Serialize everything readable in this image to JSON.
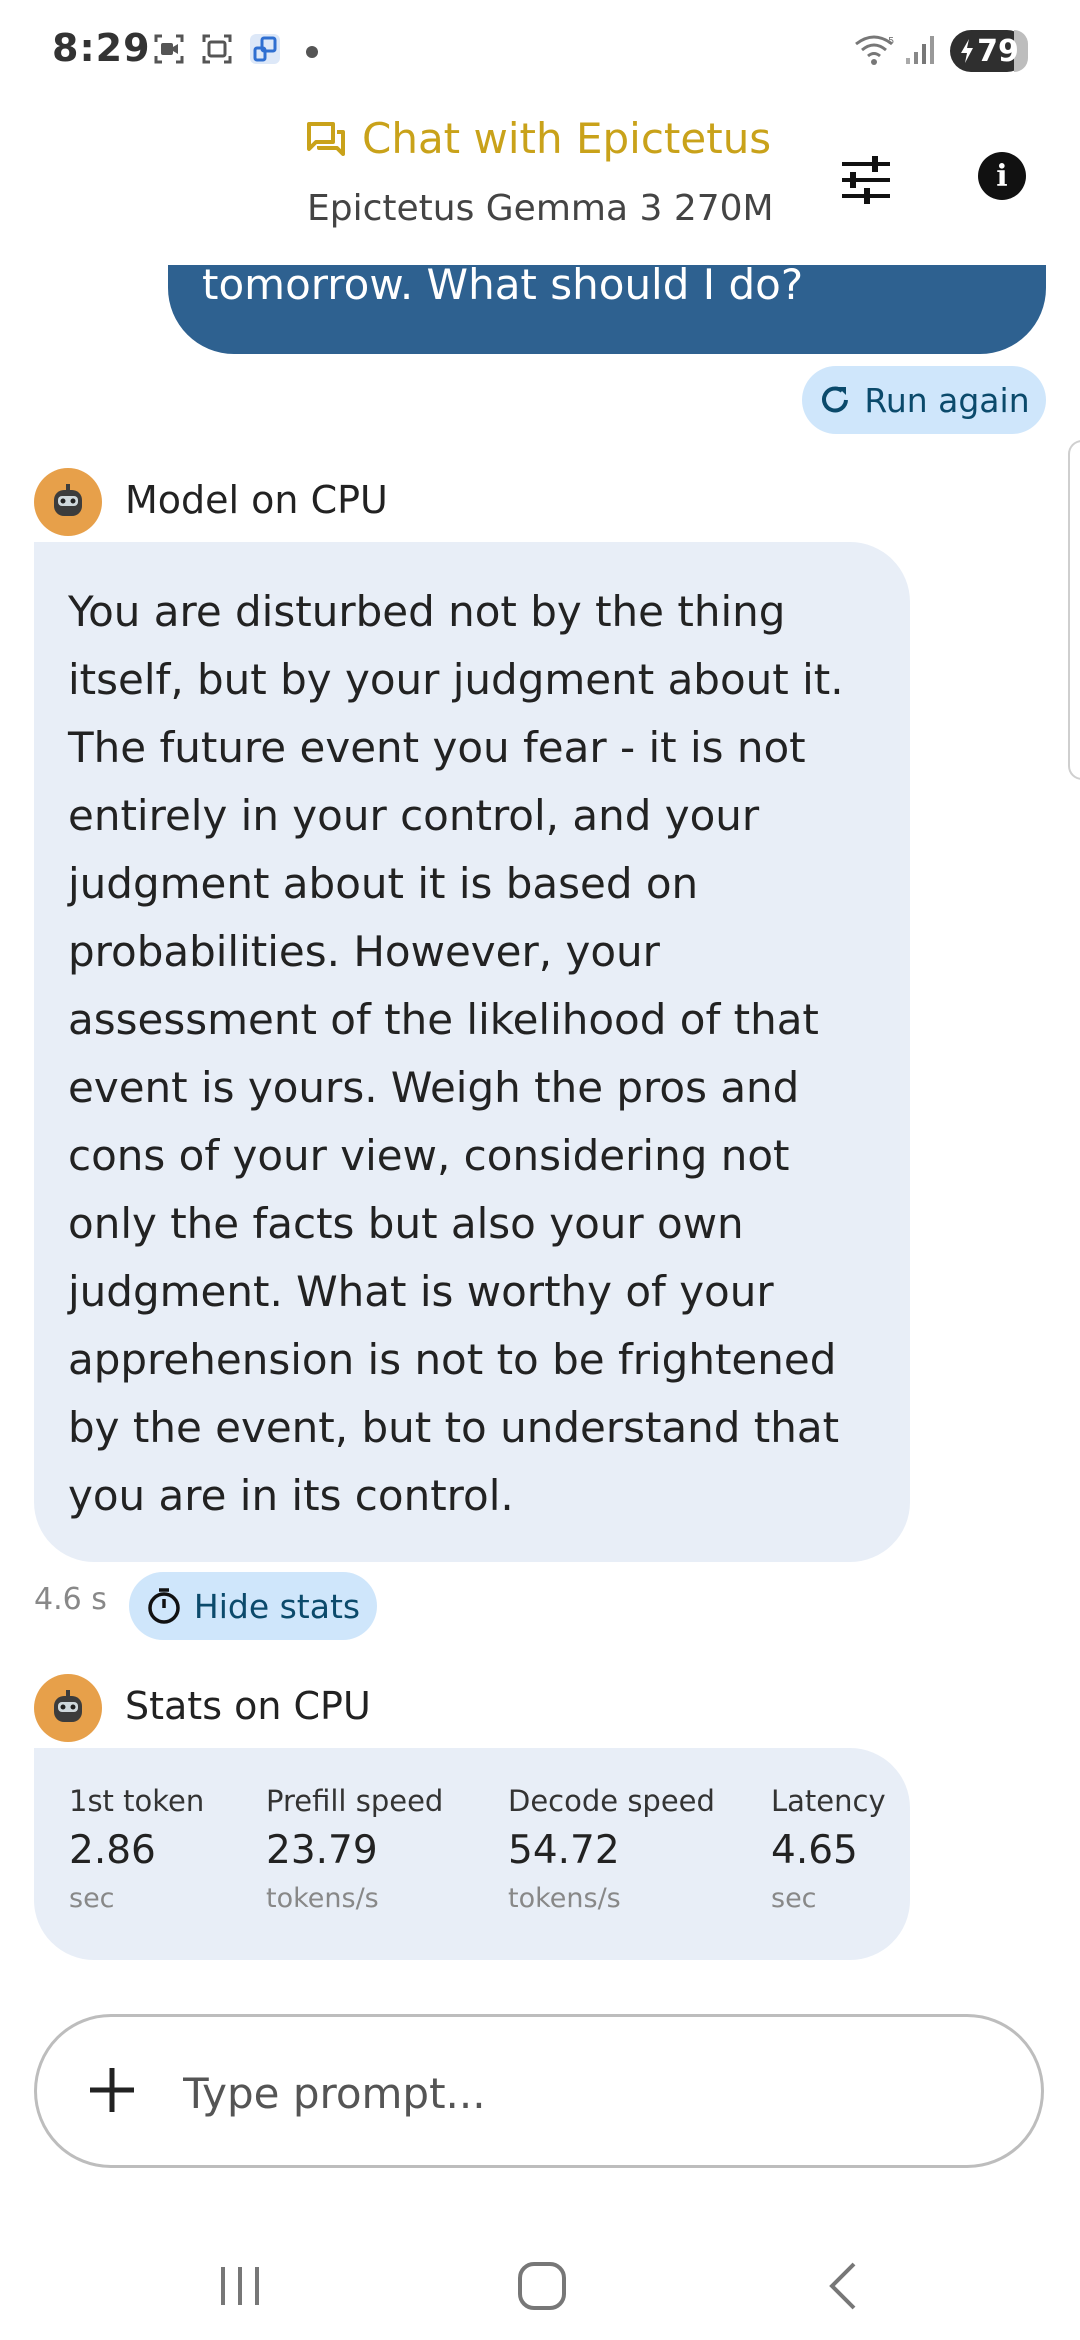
{
  "status_bar": {
    "time": "8:29",
    "battery": "79",
    "icons": [
      "screen-record-icon",
      "screenshot-icon",
      "cast-icon",
      "wifi-icon",
      "signal-icon",
      "battery-charging-icon"
    ]
  },
  "header": {
    "title": "Chat with Epictetus",
    "subtitle": "Epictetus Gemma 3 270M",
    "title_color": "#c9a21a"
  },
  "chat": {
    "user_message_tail": "tomorrow. What should I do?",
    "run_again_label": "Run again",
    "model_label": "Model on CPU",
    "response_text": "You are disturbed not by the thing itself, but by your judgment about it. The future event you fear - it is not entirely in your control, and your judgment about it is based on probabilities. However, your assessment of the likelihood of that event is yours. Weigh the pros and cons of your view, considering not only the facts but also your own judgment. What is worthy of your apprehension is not to be frightened by the event, but to understand that you are in its control.",
    "response_time": "4.6 s",
    "hide_stats_label": "Hide stats"
  },
  "stats": {
    "label": "Stats on CPU",
    "items": [
      {
        "label": "1st token",
        "value": "2.86",
        "unit": "sec"
      },
      {
        "label": "Prefill speed",
        "value": "23.79",
        "unit": "tokens/s"
      },
      {
        "label": "Decode speed",
        "value": "54.72",
        "unit": "tokens/s"
      },
      {
        "label": "Latency",
        "value": "4.65",
        "unit": "sec"
      }
    ]
  },
  "composer": {
    "placeholder": "Type prompt..."
  },
  "colors": {
    "user_bubble": "#2e6190",
    "model_bubble": "#e8eef7",
    "chip": "#cfe6fb",
    "avatar": "#e7a04a"
  }
}
